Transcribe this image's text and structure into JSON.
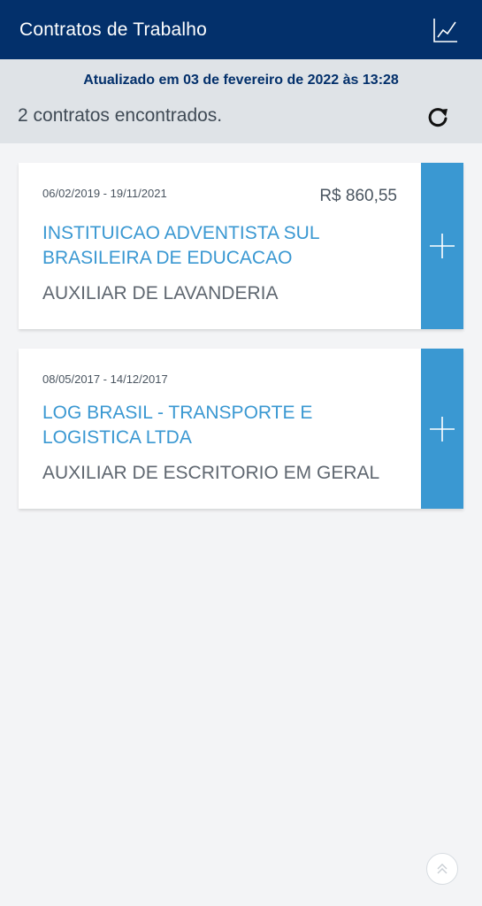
{
  "header": {
    "title": "Contratos de Trabalho",
    "chart_icon": "line-chart-icon"
  },
  "info": {
    "updated_text": "Atualizado em 03 de fevereiro de 2022 às 13:28",
    "count_text": "2 contratos encontrados.",
    "refresh_icon": "refresh-icon"
  },
  "contracts": [
    {
      "period": "06/02/2019 - 19/11/2021",
      "amount": "R$ 860,55",
      "employer": "INSTITUICAO ADVENTISTA SUL BRASILEIRA DE EDUCACAO",
      "role": "AUXILIAR DE LAVANDERIA",
      "expand_icon": "plus-icon"
    },
    {
      "period": "08/05/2017 - 14/12/2017",
      "amount": "",
      "employer": "LOG BRASIL - TRANSPORTE E LOGISTICA LTDA",
      "role": "AUXILIAR DE ESCRITORIO EM GERAL",
      "expand_icon": "plus-icon"
    }
  ],
  "scroll_top_icon": "double-chevron-up-icon",
  "colors": {
    "header_bg": "#03306b",
    "accent": "#3a98d2",
    "info_bg": "#dfe3e7",
    "page_bg": "#f3f4f6"
  }
}
